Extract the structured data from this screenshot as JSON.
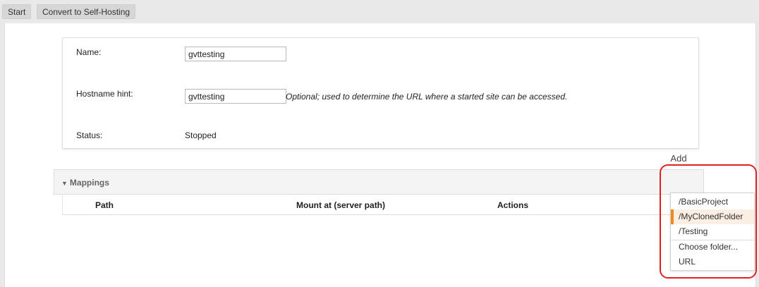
{
  "toolbar": {
    "start_label": "Start",
    "convert_label": "Convert to Self-Hosting"
  },
  "form": {
    "name_label": "Name:",
    "name_value": "gvttesting",
    "hostname_label": "Hostname hint:",
    "hostname_value": "gvttesting",
    "hostname_hint": "Optional; used to determine the URL where a started site can be accessed.",
    "status_label": "Status:",
    "status_value": "Stopped"
  },
  "mappings": {
    "title": "Mappings",
    "add_label": "Add",
    "columns": [
      "Path",
      "Mount at (server path)",
      "Actions"
    ]
  },
  "add_menu": {
    "items": [
      "/BasicProject",
      "/MyClonedFolder",
      "/Testing",
      "Choose folder...",
      "URL"
    ],
    "selected_index": 1
  },
  "colors": {
    "highlight_border": "#f08a1c",
    "highlight_bg": "#fbeee2",
    "annotation_red": "#e02020"
  }
}
